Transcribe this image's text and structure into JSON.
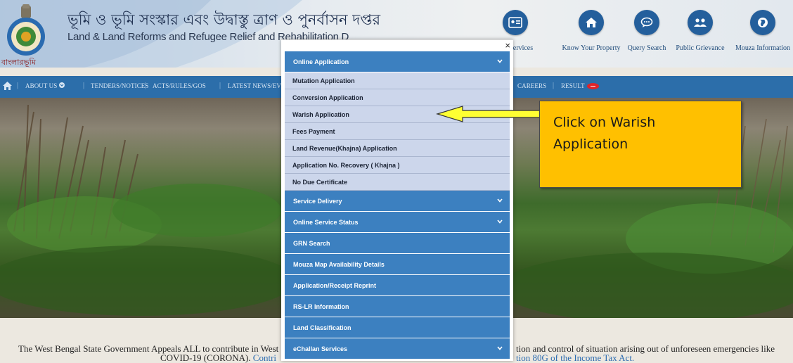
{
  "header": {
    "title_bn": "ভূমি ও ভূমি সংস্কার এবং উদ্বাস্তু ত্রাণ ও পুনর্বাসন দপ্তর",
    "title_en": "Land & Land Reforms and Refugee Relief and Rehabilitation D",
    "brand_bn": "বাংলারভূমি",
    "quick_links": [
      {
        "label": "zen Services",
        "icon": "id-card-icon"
      },
      {
        "label": "Know Your Property",
        "icon": "home-icon"
      },
      {
        "label": "Query Search",
        "icon": "chat-icon"
      },
      {
        "label": "Public Grievance",
        "icon": "users-icon"
      },
      {
        "label": "Mouza Information",
        "icon": "globe-icon"
      }
    ]
  },
  "nav": {
    "home_icon": "home-icon",
    "items": [
      "ABOUT US",
      "TENDERS/NOTICES",
      "ACTS/RULES/GOS",
      "LATEST NEWS/EV",
      "CAREERS",
      "RESULT"
    ],
    "badge": "new"
  },
  "appeal": {
    "left_line1": "The West Bengal State Government Appeals ALL to contribute in West",
    "left_line2": "COVID-19 (CORONA).",
    "left_link": "Contri",
    "right_line1": "tion and control of situation arising out of unforeseen emergencies like",
    "right_line2": "tion 80G of the Income Tax Act."
  },
  "modal": {
    "close": "×",
    "menu": [
      {
        "label": "Online Application",
        "expandable": true,
        "children": [
          "Mutation Application",
          "Conversion Application",
          "Warish Application",
          "Fees Payment",
          "Land Revenue(Khajna) Application",
          "Application No. Recovery ( Khajna )",
          "No Due Certificate"
        ]
      },
      {
        "label": "Service Delivery",
        "expandable": true
      },
      {
        "label": "Online Service Status",
        "expandable": true
      },
      {
        "label": "GRN Search",
        "expandable": false
      },
      {
        "label": "Mouza Map Availability Details",
        "expandable": false
      },
      {
        "label": "Application/Receipt Reprint",
        "expandable": false
      },
      {
        "label": "RS-LR Information",
        "expandable": false
      },
      {
        "label": "Land Classification",
        "expandable": false
      },
      {
        "label": "eChallan Services",
        "expandable": true
      }
    ]
  },
  "callout": {
    "line1": "Click on Warish",
    "line2": "Application"
  },
  "colors": {
    "menu_head": "#3c80c0",
    "submenu": "#ccd6eb",
    "navbar": "#2c6eaa",
    "callout": "#ffc000",
    "arrow": "#ffff33"
  }
}
